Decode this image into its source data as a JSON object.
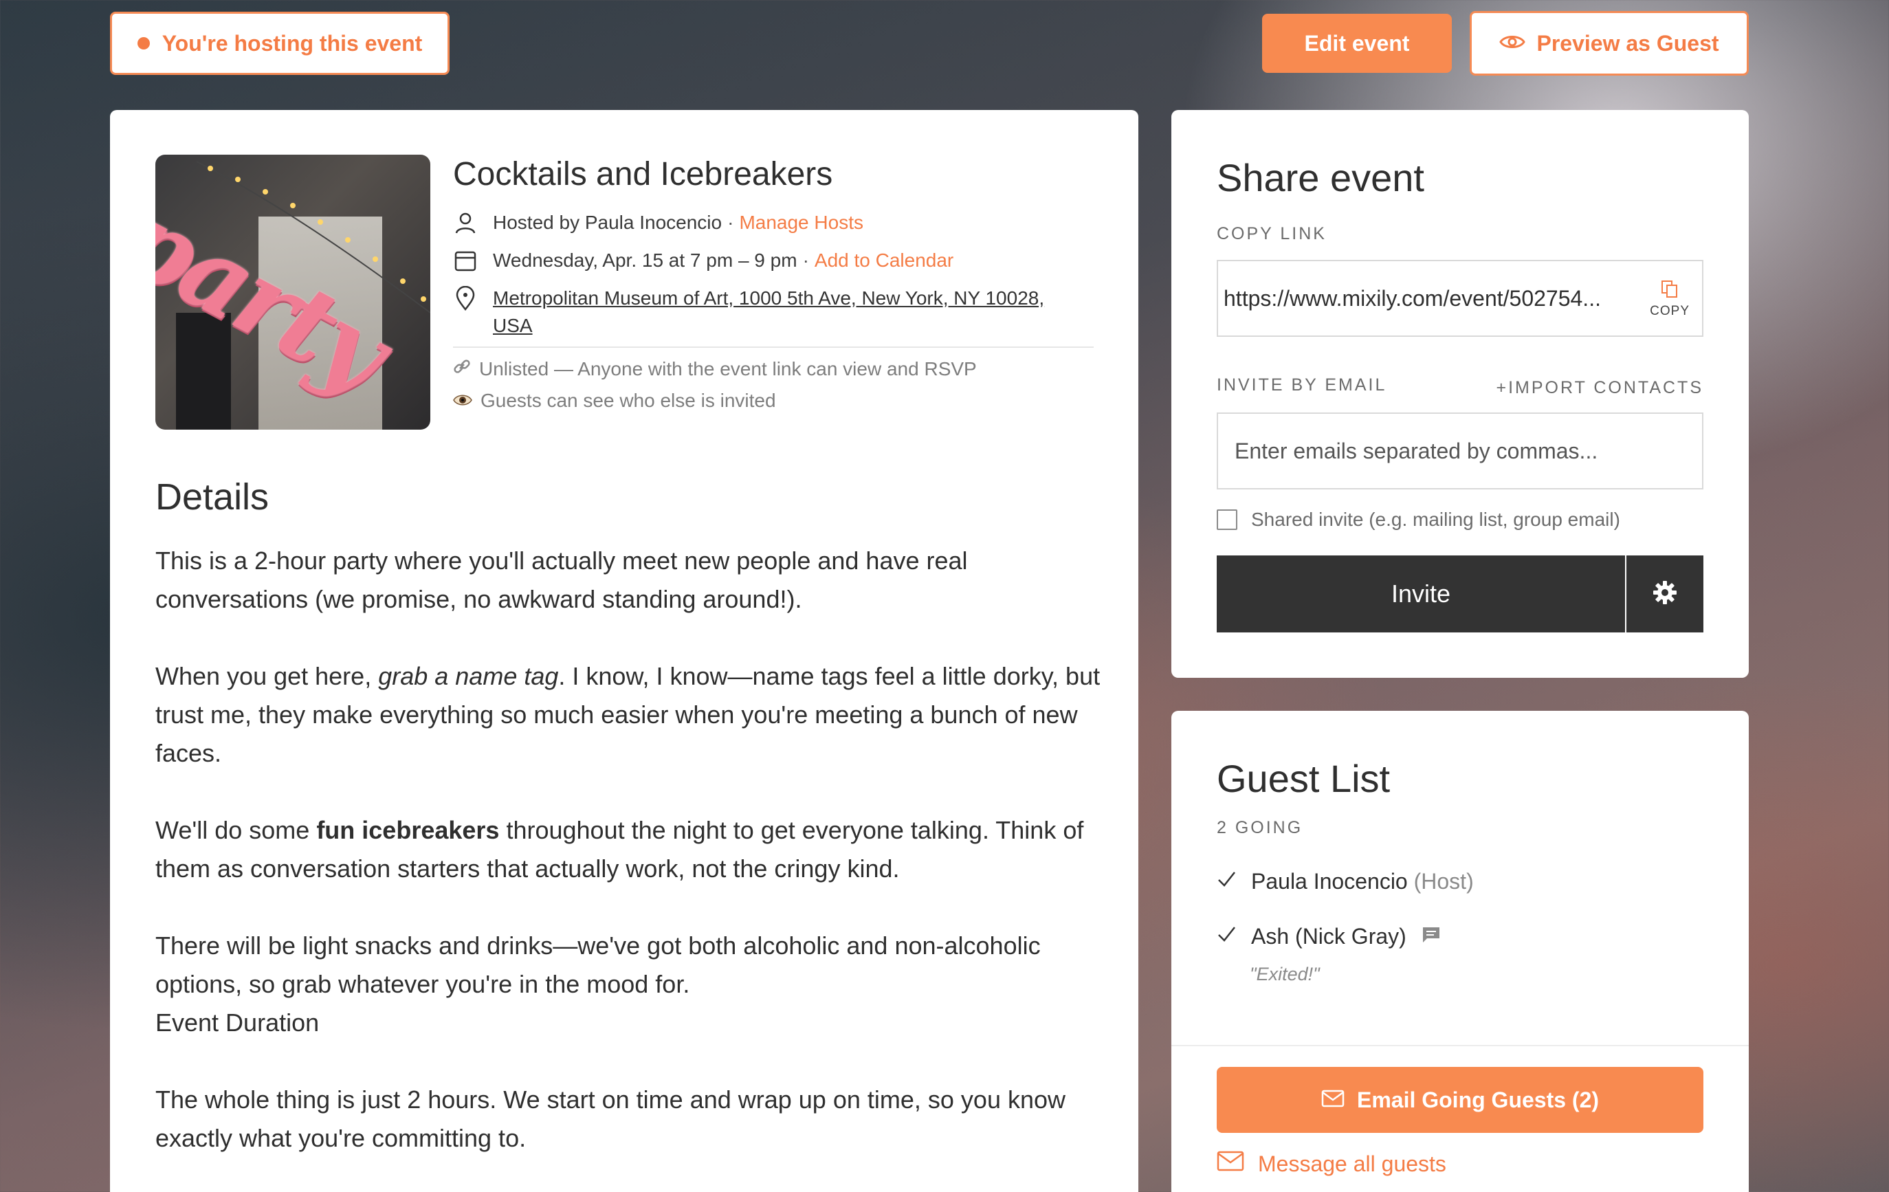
{
  "topbar": {
    "hosting_label": "You're hosting this event",
    "edit_label": "Edit event",
    "preview_label": "Preview as Guest"
  },
  "event": {
    "title": "Cocktails and Icebreakers",
    "hosted_by": "Hosted by Paula Inocencio",
    "manage_hosts": "Manage Hosts",
    "datetime": "Wednesday, Apr. 15 at 7 pm – 9 pm",
    "add_calendar": "Add to Calendar",
    "location_line1": "Metropolitan Museum of Art, 1000 5th Ave, New York, NY 10028,",
    "location_line2": "USA",
    "visibility": "Unlisted — Anyone with the event link can view and RSVP",
    "guest_visibility": "Guests can see who else is invited",
    "image_text": "party"
  },
  "details": {
    "heading": "Details",
    "p1": "This is a 2-hour party where you'll actually meet new people and have real conversations (we promise, no awkward standing around!).",
    "p2_a": "When you get here, ",
    "p2_em": "grab a name tag",
    "p2_b": ". I know, I know—name tags feel a little dorky, but trust me, they make everything so much easier when you're meeting a bunch of new faces.",
    "p3_a": "We'll do some ",
    "p3_strong": "fun icebreakers",
    "p3_b": " throughout the night to get everyone talking. Think of them as conversation starters that actually work, not the cringy kind.",
    "p4": "There will be light snacks and drinks—we've got both alcoholic and non-alcoholic options, so grab whatever you're in the mood for.",
    "p4_sub": "Event Duration",
    "p5": "The whole thing is just 2 hours. We start on time and wrap up on time, so you know exactly what you're committing to."
  },
  "share": {
    "heading": "Share event",
    "copy_link_label": "COPY LINK",
    "link": "https://www.mixily.com/event/502754...",
    "copy_btn": "COPY",
    "invite_email_label": "INVITE BY EMAIL",
    "import_contacts": "+IMPORT CONTACTS",
    "email_placeholder": "Enter emails separated by commas...",
    "shared_invite": "Shared invite (e.g. mailing list, group email)",
    "invite_btn": "Invite"
  },
  "guests": {
    "heading": "Guest List",
    "going_count": "2 GOING",
    "list": [
      {
        "name": "Paula Inocencio",
        "tag": "(Host)"
      },
      {
        "name": "Ash (Nick Gray)",
        "comment": "\"Exited!\""
      }
    ],
    "email_going_btn": "Email Going Guests (2)",
    "message_all": "Message all guests"
  },
  "colors": {
    "accent": "#f47c45",
    "accent_button": "#f88a50",
    "dark_button": "#333333"
  }
}
